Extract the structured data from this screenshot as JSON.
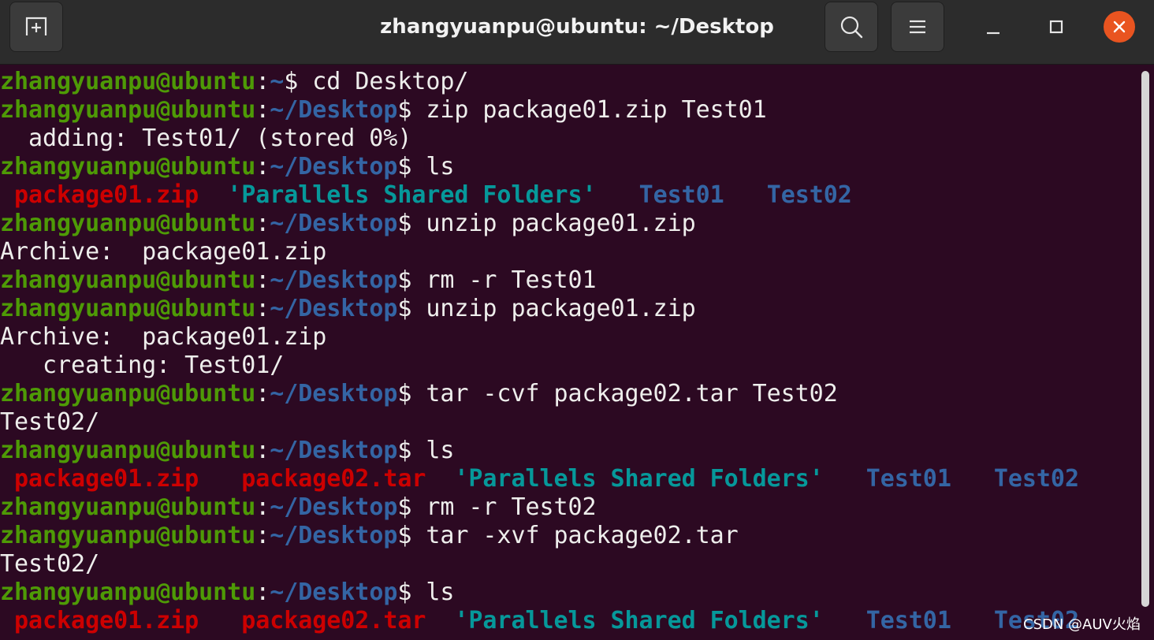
{
  "window": {
    "title": "zhangyuanpu@ubuntu: ~/Desktop"
  },
  "icons": {
    "new_tab": "new-tab-icon",
    "search": "search-icon",
    "menu": "hamburger-menu-icon",
    "minimize": "minimize-icon",
    "maximize": "maximize-icon",
    "close": "close-icon"
  },
  "colors": {
    "background": "#2c0922",
    "prompt_user": "#4e9a06",
    "prompt_path": "#3465a4",
    "text": "#eeeeec",
    "archive_file": "#cc0000",
    "shared_folder": "#06989a",
    "directory": "#3465a4",
    "close_button": "#e95420"
  },
  "terminal": {
    "lines": [
      {
        "type": "prompt",
        "user": "zhangyuanpu@ubuntu",
        "colon": ":",
        "path": "~",
        "symbol": "$ ",
        "command": "cd Desktop/"
      },
      {
        "type": "prompt",
        "user": "zhangyuanpu@ubuntu",
        "colon": ":",
        "path": "~/Desktop",
        "symbol": "$ ",
        "command": "zip package01.zip Test01"
      },
      {
        "type": "output",
        "text": "  adding: Test01/ (stored 0%)"
      },
      {
        "type": "prompt",
        "user": "zhangyuanpu@ubuntu",
        "colon": ":",
        "path": "~/Desktop",
        "symbol": "$ ",
        "command": "ls"
      },
      {
        "type": "ls",
        "items": [
          {
            "text": " package01.zip",
            "kind": "zip"
          },
          {
            "text": "  ",
            "kind": "plain"
          },
          {
            "text": "'Parallels Shared Folders'",
            "kind": "shared"
          },
          {
            "text": "   ",
            "kind": "plain"
          },
          {
            "text": "Test01",
            "kind": "dir"
          },
          {
            "text": "   ",
            "kind": "plain"
          },
          {
            "text": "Test02",
            "kind": "dir"
          }
        ]
      },
      {
        "type": "prompt",
        "user": "zhangyuanpu@ubuntu",
        "colon": ":",
        "path": "~/Desktop",
        "symbol": "$ ",
        "command": "unzip package01.zip"
      },
      {
        "type": "output",
        "text": "Archive:  package01.zip"
      },
      {
        "type": "prompt",
        "user": "zhangyuanpu@ubuntu",
        "colon": ":",
        "path": "~/Desktop",
        "symbol": "$ ",
        "command": "rm -r Test01"
      },
      {
        "type": "prompt",
        "user": "zhangyuanpu@ubuntu",
        "colon": ":",
        "path": "~/Desktop",
        "symbol": "$ ",
        "command": "unzip package01.zip"
      },
      {
        "type": "output",
        "text": "Archive:  package01.zip"
      },
      {
        "type": "output",
        "text": "   creating: Test01/"
      },
      {
        "type": "prompt",
        "user": "zhangyuanpu@ubuntu",
        "colon": ":",
        "path": "~/Desktop",
        "symbol": "$ ",
        "command": "tar -cvf package02.tar Test02"
      },
      {
        "type": "output",
        "text": "Test02/"
      },
      {
        "type": "prompt",
        "user": "zhangyuanpu@ubuntu",
        "colon": ":",
        "path": "~/Desktop",
        "symbol": "$ ",
        "command": "ls"
      },
      {
        "type": "ls",
        "items": [
          {
            "text": " package01.zip",
            "kind": "zip"
          },
          {
            "text": "   ",
            "kind": "plain"
          },
          {
            "text": "package02.tar",
            "kind": "zip"
          },
          {
            "text": "  ",
            "kind": "plain"
          },
          {
            "text": "'Parallels Shared Folders'",
            "kind": "shared"
          },
          {
            "text": "   ",
            "kind": "plain"
          },
          {
            "text": "Test01",
            "kind": "dir"
          },
          {
            "text": "   ",
            "kind": "plain"
          },
          {
            "text": "Test02",
            "kind": "dir"
          }
        ]
      },
      {
        "type": "prompt",
        "user": "zhangyuanpu@ubuntu",
        "colon": ":",
        "path": "~/Desktop",
        "symbol": "$ ",
        "command": "rm -r Test02"
      },
      {
        "type": "prompt",
        "user": "zhangyuanpu@ubuntu",
        "colon": ":",
        "path": "~/Desktop",
        "symbol": "$ ",
        "command": "tar -xvf package02.tar"
      },
      {
        "type": "output",
        "text": "Test02/"
      },
      {
        "type": "prompt",
        "user": "zhangyuanpu@ubuntu",
        "colon": ":",
        "path": "~/Desktop",
        "symbol": "$ ",
        "command": "ls"
      },
      {
        "type": "ls",
        "items": [
          {
            "text": " package01.zip",
            "kind": "zip"
          },
          {
            "text": "   ",
            "kind": "plain"
          },
          {
            "text": "package02.tar",
            "kind": "zip"
          },
          {
            "text": "  ",
            "kind": "plain"
          },
          {
            "text": "'Parallels Shared Folders'",
            "kind": "shared"
          },
          {
            "text": "   ",
            "kind": "plain"
          },
          {
            "text": "Test01",
            "kind": "dir"
          },
          {
            "text": "   ",
            "kind": "plain"
          },
          {
            "text": "Test02",
            "kind": "dir"
          }
        ]
      }
    ]
  },
  "watermark": "CSDN @AUV火焰"
}
